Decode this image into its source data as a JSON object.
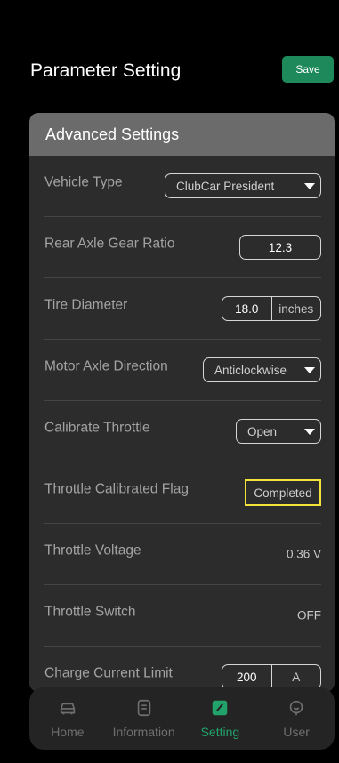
{
  "header": {
    "title": "Parameter Setting",
    "save_label": "Save"
  },
  "panel": {
    "title": "Advanced Settings",
    "rows": [
      {
        "label": "Vehicle Type",
        "control": "select",
        "value": "ClubCar President"
      },
      {
        "label": "Rear Axle Gear Ratio",
        "control": "value",
        "value": "12.3"
      },
      {
        "label": "Tire Diameter",
        "control": "unit",
        "value": "18.0",
        "unit": "inches"
      },
      {
        "label": "Motor Axle Direction",
        "control": "select",
        "value": "Anticlockwise"
      },
      {
        "label": "Calibrate Throttle",
        "control": "select",
        "value": "Open"
      },
      {
        "label": "Throttle Calibrated Flag",
        "control": "flag",
        "value": "Completed"
      },
      {
        "label": "Throttle Voltage",
        "control": "text",
        "value": "0.36 V"
      },
      {
        "label": "Throttle Switch",
        "control": "text",
        "value": "OFF"
      },
      {
        "label": "Charge Current Limit",
        "control": "unit",
        "value": "200",
        "unit": "A"
      }
    ]
  },
  "nav": {
    "items": [
      {
        "label": "Home",
        "icon": "car-icon",
        "active": false
      },
      {
        "label": "Information",
        "icon": "document-icon",
        "active": false
      },
      {
        "label": "Setting",
        "icon": "edit-icon",
        "active": true
      },
      {
        "label": "User",
        "icon": "user-icon",
        "active": false
      }
    ]
  },
  "colors": {
    "accent": "#22a36b",
    "save": "#1e8a5c",
    "highlight": "#f2e23a"
  }
}
